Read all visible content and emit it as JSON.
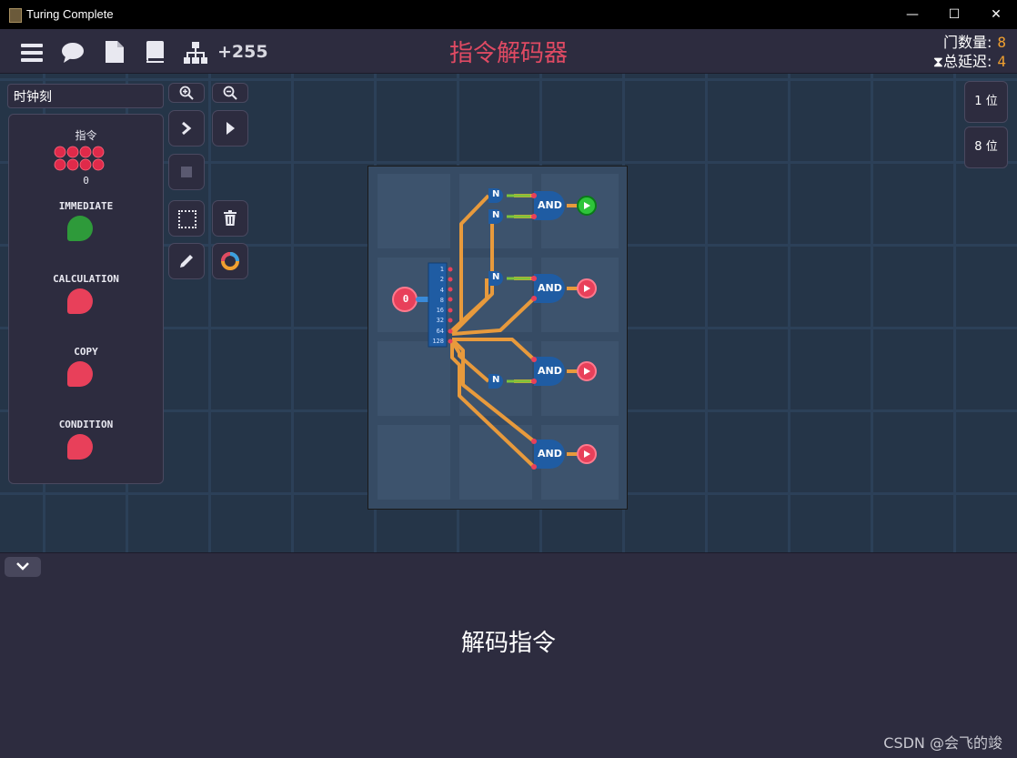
{
  "window": {
    "title": "Turing Complete",
    "controls": [
      "—",
      "☐",
      "✕"
    ]
  },
  "toolbar": {
    "icons": [
      "menu-icon",
      "chat-icon",
      "file-icon",
      "book-icon",
      "hierarchy-icon"
    ],
    "score": "+255"
  },
  "level": {
    "title": "指令解码器"
  },
  "stats": {
    "gate_label": "门数量:",
    "gate_value": "8",
    "delay_label": "总延迟:",
    "delay_value": "4"
  },
  "sidebar": {
    "mode_select": "时钟刻",
    "mode_toggle": "–",
    "input_label": "指令",
    "input_value": "0",
    "outputs": [
      {
        "label": "IMMEDIATE",
        "state": "on"
      },
      {
        "label": "CALCULATION",
        "state": "off"
      },
      {
        "label": "COPY",
        "state": "off"
      },
      {
        "label": "CONDITION",
        "state": "off"
      }
    ]
  },
  "right_buttons": {
    "one_bit": "1 位",
    "eight_bit": "8 位"
  },
  "circuit": {
    "input_value": "0",
    "bit_labels": [
      "1",
      "2",
      "4",
      "8",
      "16",
      "32",
      "64",
      "128"
    ],
    "not_label": "N",
    "and_label": "AND"
  },
  "bottom": {
    "description": "解码指令"
  },
  "watermark": "CSDN @会飞的竣",
  "colors": {
    "accent_title": "#e04a63",
    "stat_number": "#f0a030",
    "wire": "#e89a3c",
    "pin_on": "#2e9a3a",
    "pin_off": "#e8405a",
    "gate": "#1f5ca3",
    "background": "#2b2a3d"
  }
}
